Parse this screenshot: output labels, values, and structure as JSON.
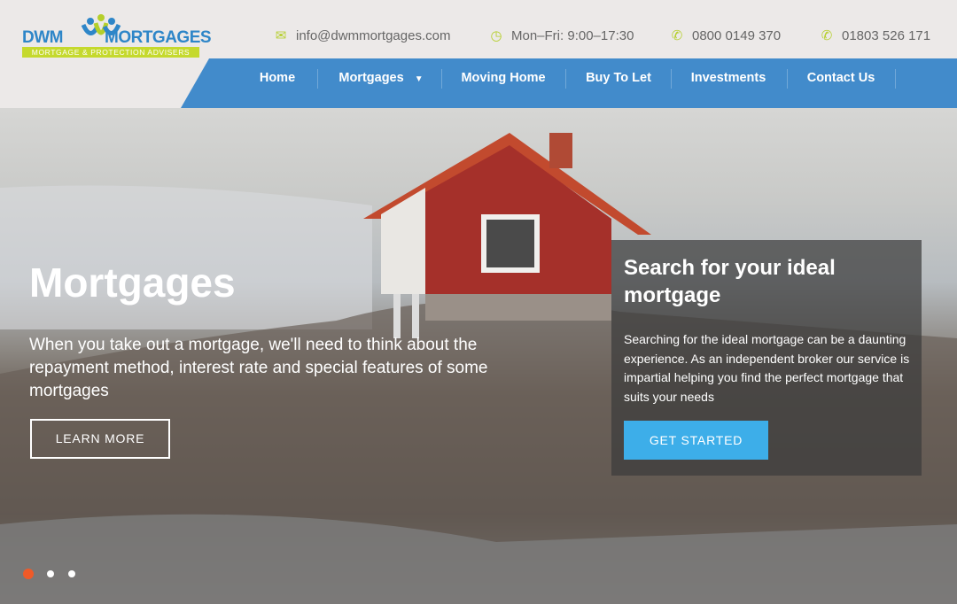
{
  "logo": {
    "left": "DWM",
    "right": "MORTGAGES",
    "tagline": "MORTGAGE & PROTECTION ADVISERS"
  },
  "contact": {
    "email": "info@dwmmortgages.com",
    "hours": "Mon–Fri: 9:00–17:30",
    "phone1": "0800 0149 370",
    "phone2": "01803 526 171"
  },
  "nav": {
    "items": [
      {
        "label": "Home"
      },
      {
        "label": "Mortgages"
      },
      {
        "label": "Moving Home"
      },
      {
        "label": "Buy To Let"
      },
      {
        "label": "Investments"
      },
      {
        "label": "Contact Us"
      }
    ]
  },
  "hero": {
    "title": "Mortgages",
    "text": "When you take out a mortgage, we'll need to think about the repayment method, interest rate and special features of some mortgages",
    "button": "LEARN MORE"
  },
  "search_box": {
    "title": "Search for your ideal mortgage",
    "text": "Searching for the ideal mortgage can be a daunting experience. As an independent broker our service is impartial helping you find the perfect mortgage that suits your needs",
    "button": "GET STARTED"
  },
  "slider": {
    "count": 3,
    "active": 1
  },
  "colors": {
    "nav": "#428bcb",
    "accent": "#b5cf2a",
    "cta": "#3daee9",
    "active_dot": "#f05a28"
  }
}
